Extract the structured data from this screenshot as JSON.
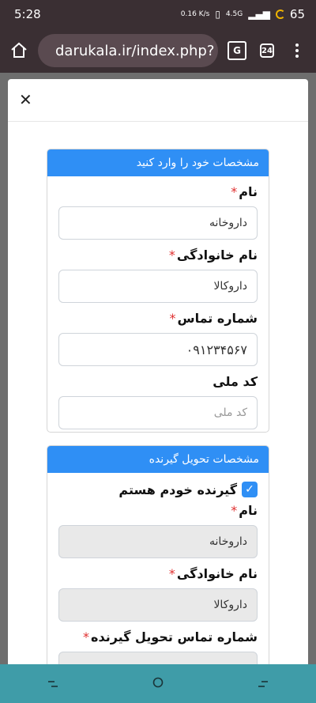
{
  "status_bar": {
    "time": "5:28",
    "net_speed": "0.16 K/s",
    "network": "4.5G",
    "battery": "65"
  },
  "browser": {
    "url": "darukala.ir/index.php?",
    "tab_count": "24",
    "translate_icon": "translate-icon"
  },
  "modal": {
    "close_label": "✕",
    "sender_card": {
      "header": "مشخصات خود را وارد کنید",
      "fields": {
        "first_name": {
          "label": "نام",
          "value": "داروخانه"
        },
        "last_name": {
          "label": "نام خانوادگی",
          "value": "داروکالا"
        },
        "phone": {
          "label": "شماره تماس",
          "value": "۰۹۱۲۳۴۵۶۷"
        },
        "national_id": {
          "label": "کد ملی",
          "placeholder": "کد ملی"
        }
      },
      "required_mark": "*"
    },
    "recipient_card": {
      "header": "مشخصات تحویل گیرنده",
      "self_recipient_label": "گیرنده خودم هستم",
      "fields": {
        "first_name": {
          "label": "نام",
          "value": "داروخانه"
        },
        "last_name": {
          "label": "نام خانوادگی",
          "value": "داروکالا"
        },
        "phone": {
          "label": "شماره تماس تحویل گیرنده"
        }
      }
    }
  },
  "colors": {
    "accent": "#2f8ff5",
    "required": "#e03030",
    "navbar": "#3f9ca8",
    "browser_chrome": "#3a2f33"
  }
}
